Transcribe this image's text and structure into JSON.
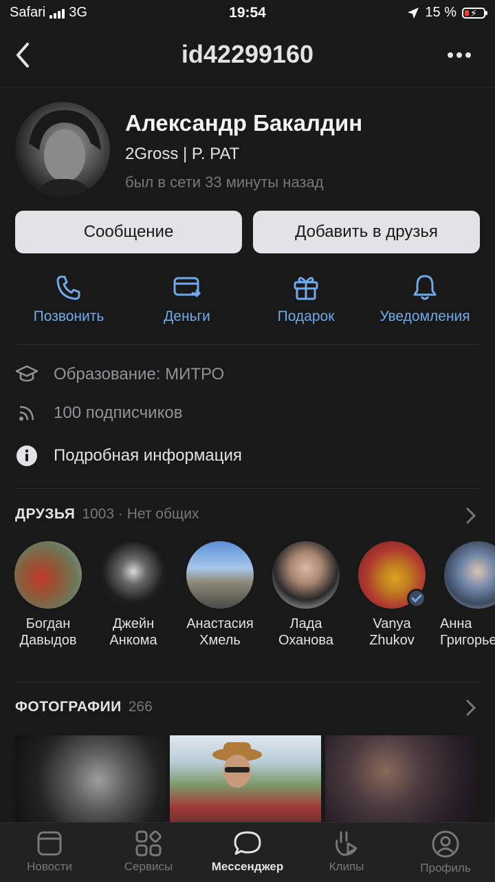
{
  "status_bar": {
    "carrier": "Safari",
    "network": "3G",
    "time": "19:54",
    "battery": "15 %"
  },
  "header": {
    "title": "id42299160"
  },
  "profile": {
    "name": "Александр Бакалдин",
    "status": "2Gross | P. PAT",
    "last_seen": "был в сети 33 минуты назад"
  },
  "buttons": {
    "message": "Сообщение",
    "add_friend": "Добавить в друзья"
  },
  "actions": [
    {
      "label": "Позвонить",
      "icon": "phone-icon"
    },
    {
      "label": "Деньги",
      "icon": "money-transfer-icon"
    },
    {
      "label": "Подарок",
      "icon": "gift-icon"
    },
    {
      "label": "Уведомления",
      "icon": "bell-icon"
    }
  ],
  "info": {
    "education": "Образование: МИТРО",
    "followers": "100 подписчиков",
    "details": "Подробная информация"
  },
  "friends": {
    "title": "ДРУЗЬЯ",
    "count": "1003 · Нет общих",
    "items": [
      {
        "first": "Богдан",
        "last": "Давыдов"
      },
      {
        "first": "Джейн",
        "last": "Анкома"
      },
      {
        "first": "Анастасия",
        "last": "Хмель"
      },
      {
        "first": "Лада",
        "last": "Оханова"
      },
      {
        "first": "Vanya",
        "last": "Zhukov"
      },
      {
        "first": "Анна",
        "last": "Григорьева"
      }
    ]
  },
  "photos": {
    "title": "ФОТОГРАФИИ",
    "count": "266"
  },
  "tabbar": [
    {
      "label": "Новости",
      "icon": "news-icon"
    },
    {
      "label": "Сервисы",
      "icon": "services-icon"
    },
    {
      "label": "Мессенджер",
      "icon": "messenger-icon"
    },
    {
      "label": "Клипы",
      "icon": "clips-icon"
    },
    {
      "label": "Профиль",
      "icon": "profile-icon"
    }
  ],
  "colors": {
    "accent": "#71aaeb",
    "background": "#19191a",
    "button": "#e1e3e6"
  }
}
